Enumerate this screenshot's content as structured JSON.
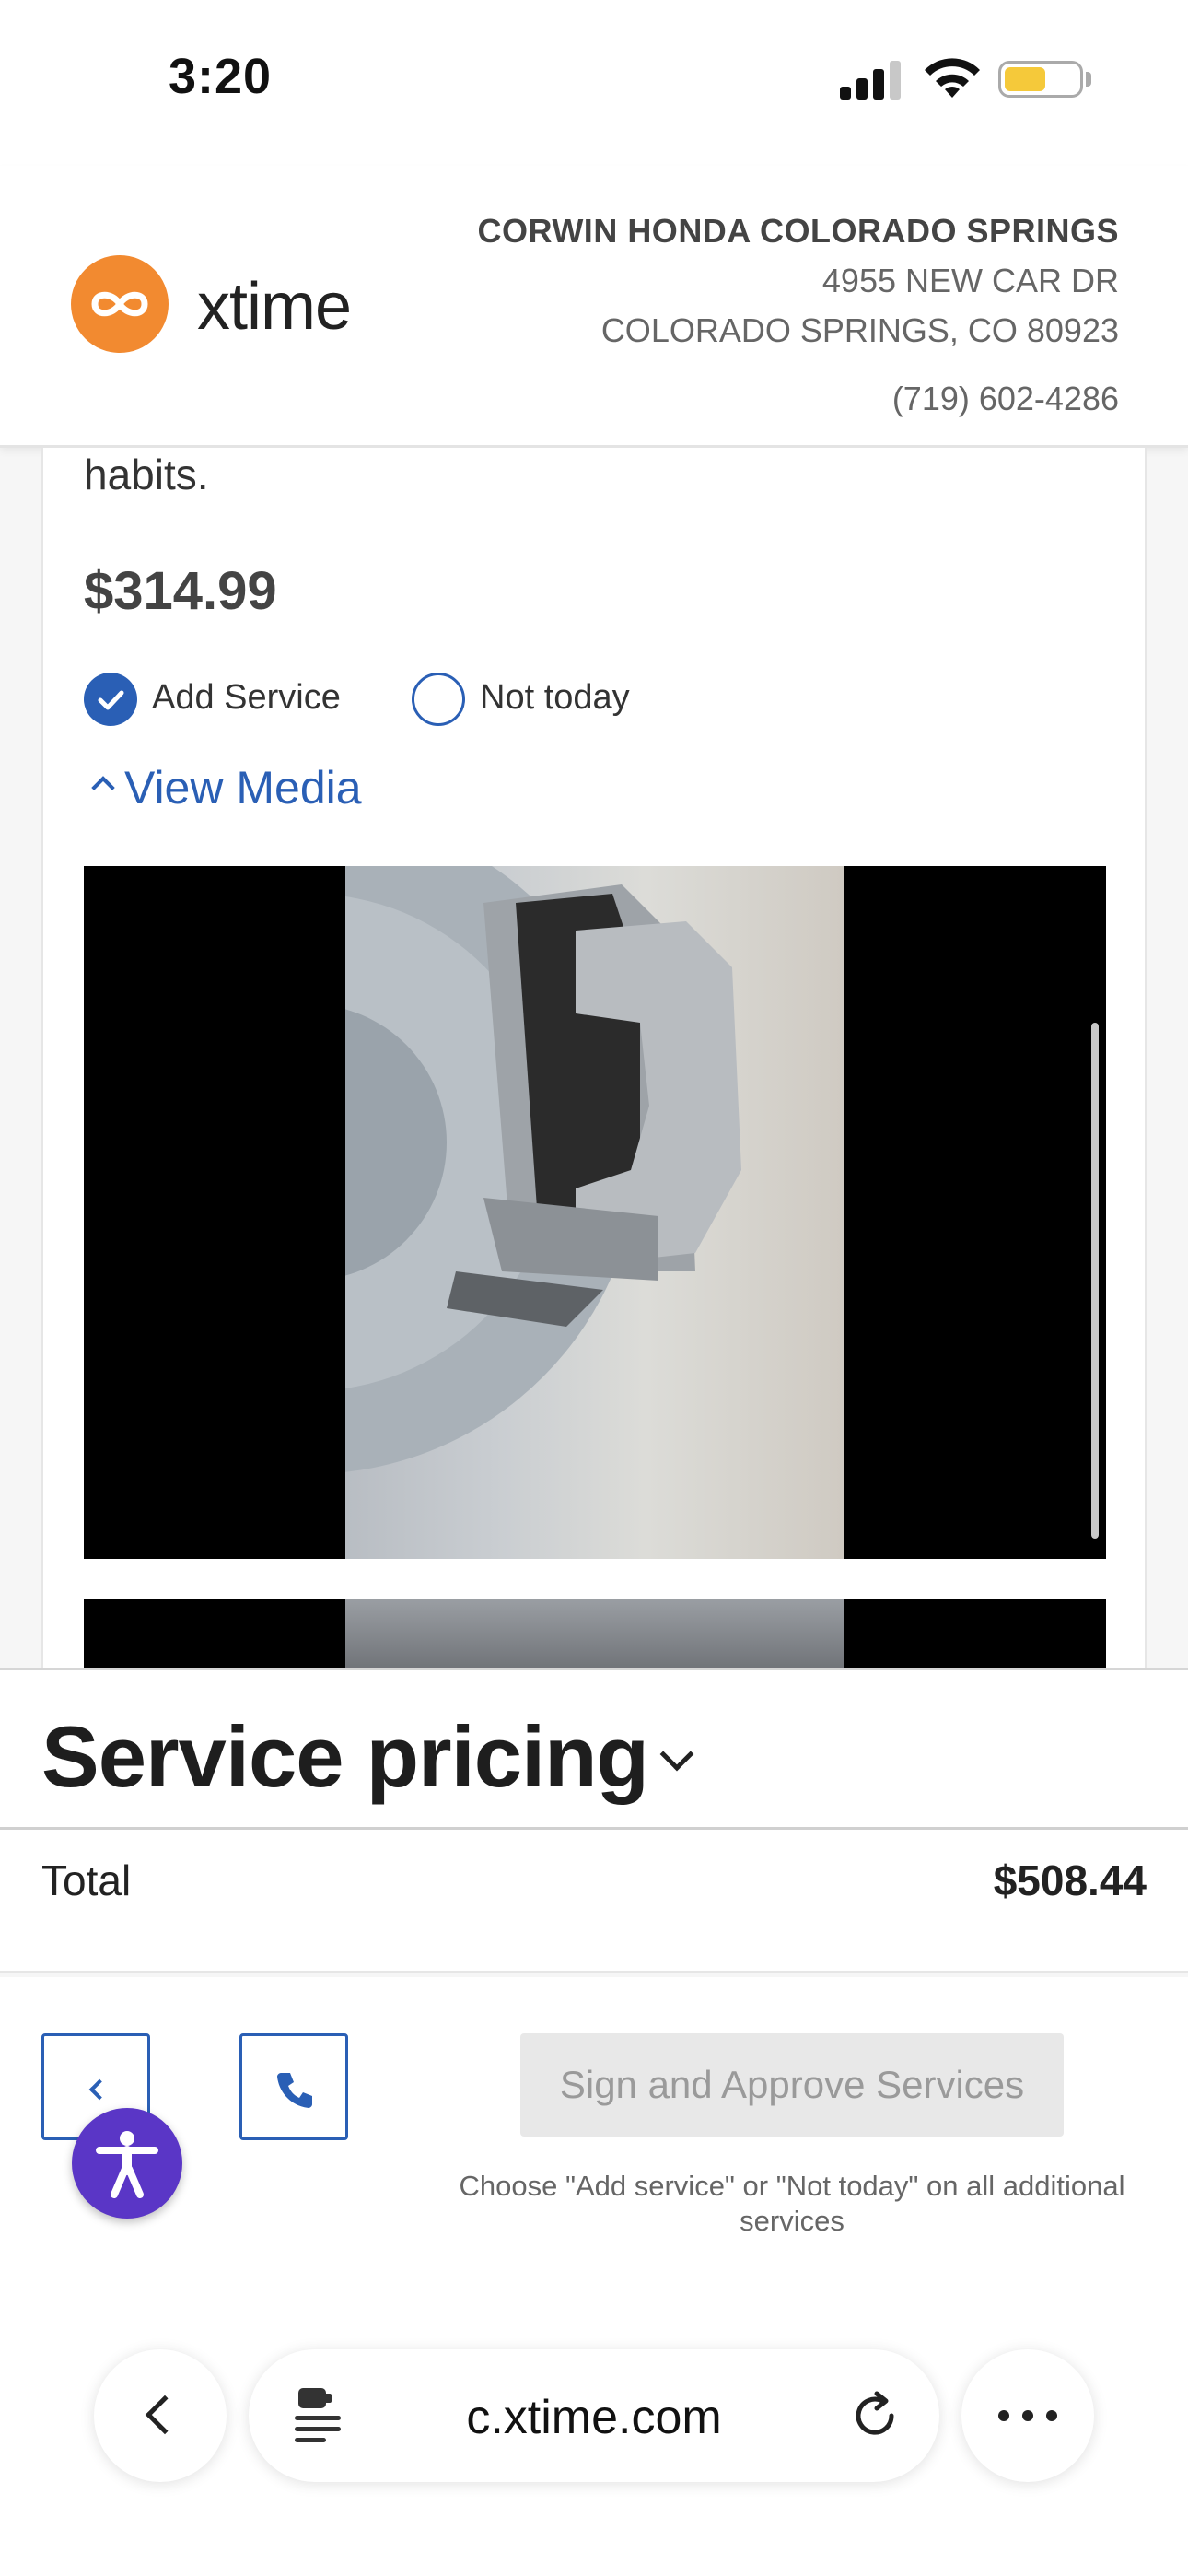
{
  "status_bar": {
    "time": "3:20",
    "battery_level": 0.55
  },
  "header": {
    "brand": "xtime",
    "dealer_name": "CORWIN HONDA COLORADO SPRINGS",
    "address_line1": "4955 NEW CAR DR",
    "address_line2": "COLORADO SPRINGS, CO 80923",
    "phone": "(719) 602-4286"
  },
  "service": {
    "description_tail": "habits.",
    "price": "$314.99",
    "option_add": "Add Service",
    "option_decline": "Not today",
    "selected_option": "Add Service",
    "view_media": "View Media"
  },
  "pricing": {
    "title": "Service pricing",
    "total_label": "Total",
    "total_value": "$508.44"
  },
  "actions": {
    "approve_label": "Sign and Approve Services",
    "approve_note": "Choose \"Add service\" or \"Not today\" on all additional services"
  },
  "browser": {
    "url": "c.xtime.com"
  },
  "colors": {
    "accent": "#2a5fb5",
    "brand_orange": "#f28a30",
    "accessibility_purple": "#5a36c6"
  }
}
